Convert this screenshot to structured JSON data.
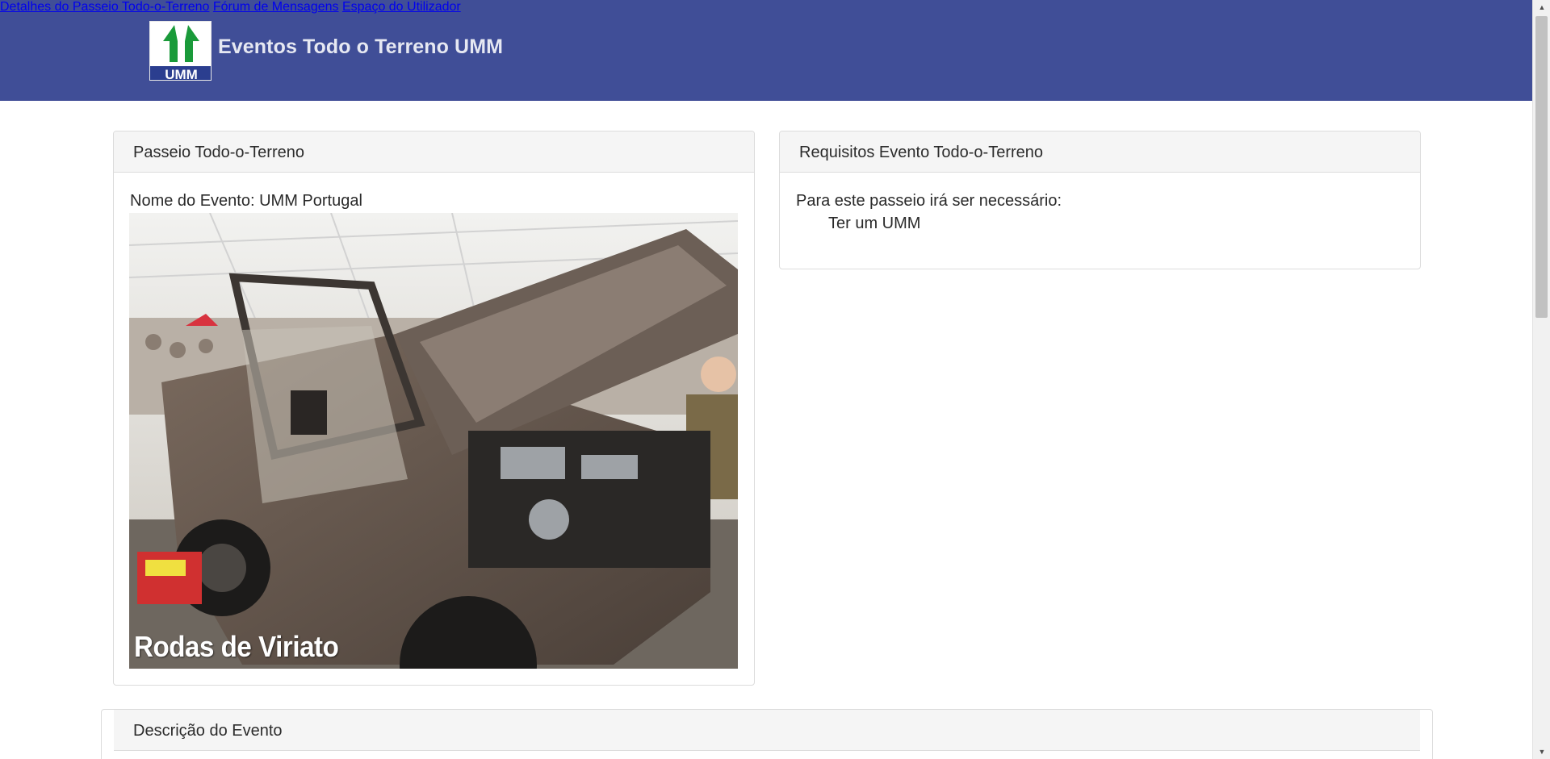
{
  "header": {
    "brand_title": "Eventos Todo o Terreno UMM",
    "logo_text": "UMM",
    "nav": [
      {
        "label": "Detalhes do Passeio Todo-o-Terreno"
      },
      {
        "label": "Fórum de Mensagens"
      },
      {
        "label": "Espaço do Utilizador"
      }
    ]
  },
  "event_card": {
    "title": "Passeio Todo-o-Terreno",
    "name_label": "Nome do Evento: UMM Portugal",
    "photo_caption": "Rodas de Viriato"
  },
  "requirements_card": {
    "title": "Requisitos Evento Todo-o-Terreno",
    "intro": "Para este passeio irá ser necessário:",
    "items": [
      "Ter um UMM"
    ]
  },
  "description_card": {
    "title": "Descrição do Evento"
  },
  "colors": {
    "navbar": "#404e97",
    "logo_green": "#1a9a3a",
    "logo_blue": "#2b3e8f"
  }
}
